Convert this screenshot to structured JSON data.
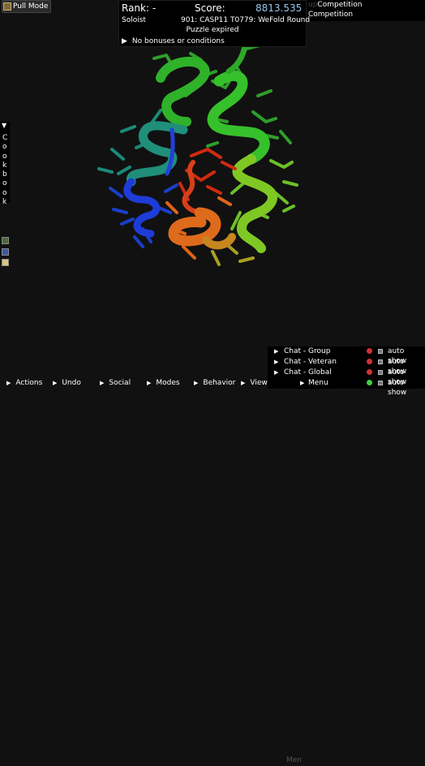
{
  "pull_mode": {
    "label": "Pull Mode",
    "icon": "pull-mode-icon"
  },
  "competition": {
    "line1_ghost": "up",
    "line1": "Competition",
    "line2_ghost": "",
    "line2": "Competition"
  },
  "score_panel": {
    "rank": "Rank: -",
    "score_label": "Score:",
    "score_value": "8813.535",
    "player_mode": "Soloist",
    "puzzle_name": "901: CASP11 T0779: WeFold Round",
    "status": "Puzzle expired",
    "bonuses": "No bonuses or conditions"
  },
  "cookbook": {
    "letters": [
      "C",
      "o",
      "o",
      "k",
      "b",
      "o",
      "o",
      "k"
    ],
    "toggle": "▼"
  },
  "side_icons": [
    "chat-icon",
    "save-icon",
    "notes-icon"
  ],
  "chat": [
    {
      "label": "Chat - Group",
      "auto": "auto show",
      "dot": "#d43232"
    },
    {
      "label": "Chat - Veteran",
      "auto": "auto show",
      "dot": "#d43232"
    },
    {
      "label": "Chat - Global",
      "auto": "auto show",
      "dot": "#d43232"
    },
    {
      "label": "Menu",
      "auto": "auto show",
      "dot": "#3fcf3f"
    }
  ],
  "bottom_bar": [
    "Actions",
    "Undo",
    "Social",
    "Modes",
    "Behavior",
    "View"
  ],
  "bottom_overlay": "Men"
}
